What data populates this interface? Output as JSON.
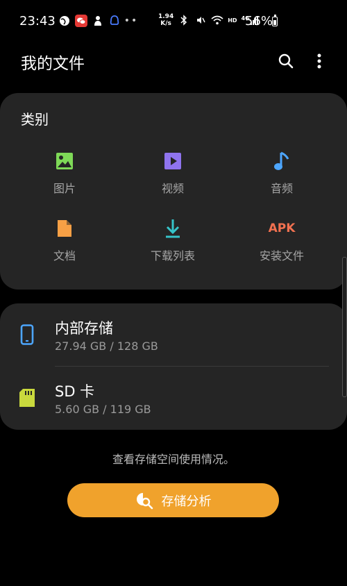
{
  "status_bar": {
    "time": "23:43",
    "net_speed_value": "1.94",
    "net_speed_unit": "K/s",
    "network_label": "HD",
    "signal_label": "4G",
    "battery_percent": "56%"
  },
  "header": {
    "title": "我的文件"
  },
  "categories": {
    "heading": "类别",
    "items": [
      {
        "label": "图片",
        "icon": "image-icon",
        "color": "#7ed957"
      },
      {
        "label": "视频",
        "icon": "video-icon",
        "color": "#8f74ee"
      },
      {
        "label": "音频",
        "icon": "music-icon",
        "color": "#4da6ff"
      },
      {
        "label": "文档",
        "icon": "document-icon",
        "color": "#f7a045"
      },
      {
        "label": "下载列表",
        "icon": "download-icon",
        "color": "#36c4c9"
      },
      {
        "label": "安装文件",
        "icon": "apk-icon",
        "icon_text": "APK",
        "color": "#f27150"
      }
    ]
  },
  "storage": {
    "items": [
      {
        "name": "内部存储",
        "usage": "27.94 GB / 128 GB",
        "icon": "phone-icon",
        "color": "#4da6ff"
      },
      {
        "name": "SD 卡",
        "usage": "5.60 GB / 119 GB",
        "icon": "sd-card-icon",
        "color": "#c9d93d"
      }
    ]
  },
  "hint": "查看存储空间使用情况。",
  "analyze_button": {
    "label": "存储分析",
    "color": "#f0a22c"
  }
}
